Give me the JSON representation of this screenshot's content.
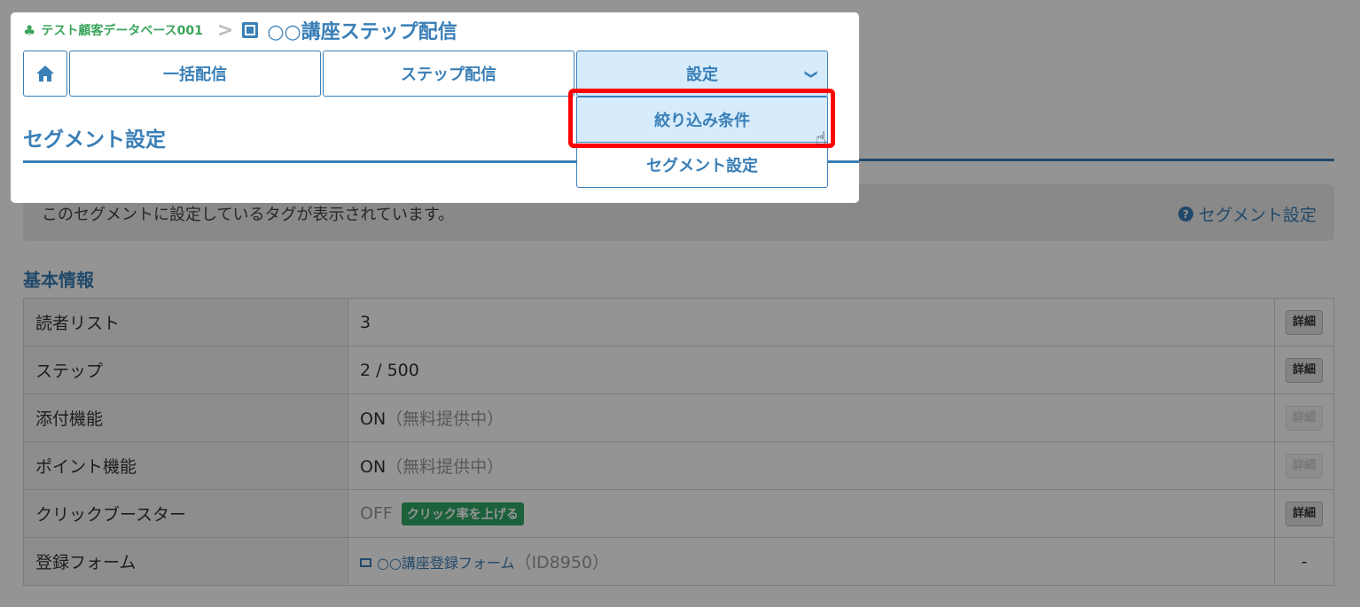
{
  "breadcrumb": {
    "database": "テスト顧客データベース001",
    "separator": ">",
    "page": "○○講座ステップ配信"
  },
  "tabs": {
    "home_icon": "home-icon",
    "items": [
      {
        "label": "一括配信"
      },
      {
        "label": "ステップ配信"
      },
      {
        "label": "設定"
      }
    ]
  },
  "dropdown": {
    "items": [
      {
        "label": "絞り込み条件",
        "highlighted": true
      },
      {
        "label": "セグメント設定"
      }
    ]
  },
  "section": {
    "title": "セグメント設定",
    "info_text": "このセグメントに設定しているタグが表示されています。",
    "help_link": "セグメント設定"
  },
  "basic_info": {
    "title": "基本情報",
    "rows": [
      {
        "label": "読者リスト",
        "value": "3",
        "action": "詳細"
      },
      {
        "label": "ステップ",
        "value": "2 / 500",
        "action": "詳細"
      },
      {
        "label": "添付機能",
        "value": "ON",
        "note": "（無料提供中）",
        "action": "詳細"
      },
      {
        "label": "ポイント機能",
        "value": "ON",
        "note": "（無料提供中）",
        "action": "詳細"
      },
      {
        "label": "クリックブースター",
        "value": "OFF",
        "badge": "クリック率を上げる",
        "action": "詳細"
      },
      {
        "label": "登録フォーム",
        "value": "○○講座登録フォーム",
        "note": "（ID8950）",
        "action": "-"
      }
    ]
  },
  "colors": {
    "accent": "#3a7fb7",
    "highlight": "#ff0000",
    "badge": "#2fa866",
    "db_green": "#3ba55c"
  }
}
